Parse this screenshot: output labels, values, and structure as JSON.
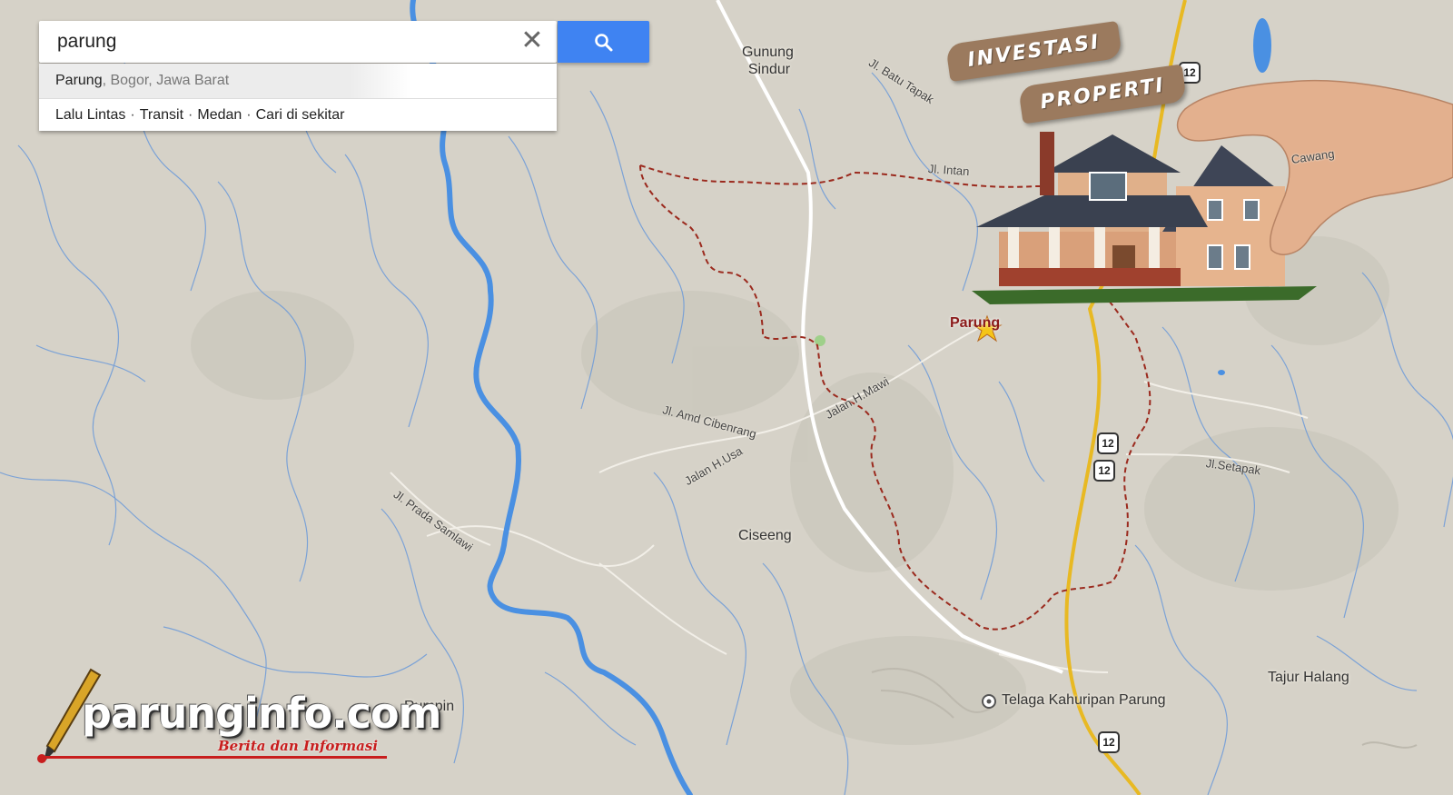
{
  "search": {
    "query": "parung",
    "clear_icon": "close-icon",
    "button_icon": "search-icon"
  },
  "suggestion": {
    "primary": "Parung",
    "secondary": ", Bogor, Jawa Barat"
  },
  "quick_links": [
    "Lalu Lintas",
    "Transit",
    "Medan",
    "Cari di sekitar"
  ],
  "quick_link_separator": "·",
  "places": {
    "gunung_sindur_1": "Gunung",
    "gunung_sindur_2": "Sindur",
    "ciseeng": "Ciseeng",
    "rumpin": "Rumpin",
    "tajur_halang": "Tajur Halang",
    "telaga": "Telaga Kahuripan Parung",
    "parung": "Parung"
  },
  "roads": {
    "batu_tapak": "Jl. Batu Tapak",
    "intan": "Jl. Intan",
    "amd": "Jl. Amd Cibenrang",
    "h_mawi": "Jalan H.Mawi",
    "h_usa": "Jalan H.Usa",
    "prada": "Jl. Prada Samlawi",
    "setapak": "Jl.Setapak",
    "cawang": "Cawang"
  },
  "route_number": "12",
  "promo": {
    "line1": "INVESTASI",
    "line2": "PROPERTI"
  },
  "logo": {
    "name": "parunginfo.com",
    "tagline": "Berita dan Informasi"
  },
  "colors": {
    "land": "#d6d2c8",
    "river": "#4a90e2",
    "stream": "#5b8fd6",
    "highway": "#e8b923",
    "boundary": "#9b2a1e",
    "search_button": "#3f83f2"
  }
}
